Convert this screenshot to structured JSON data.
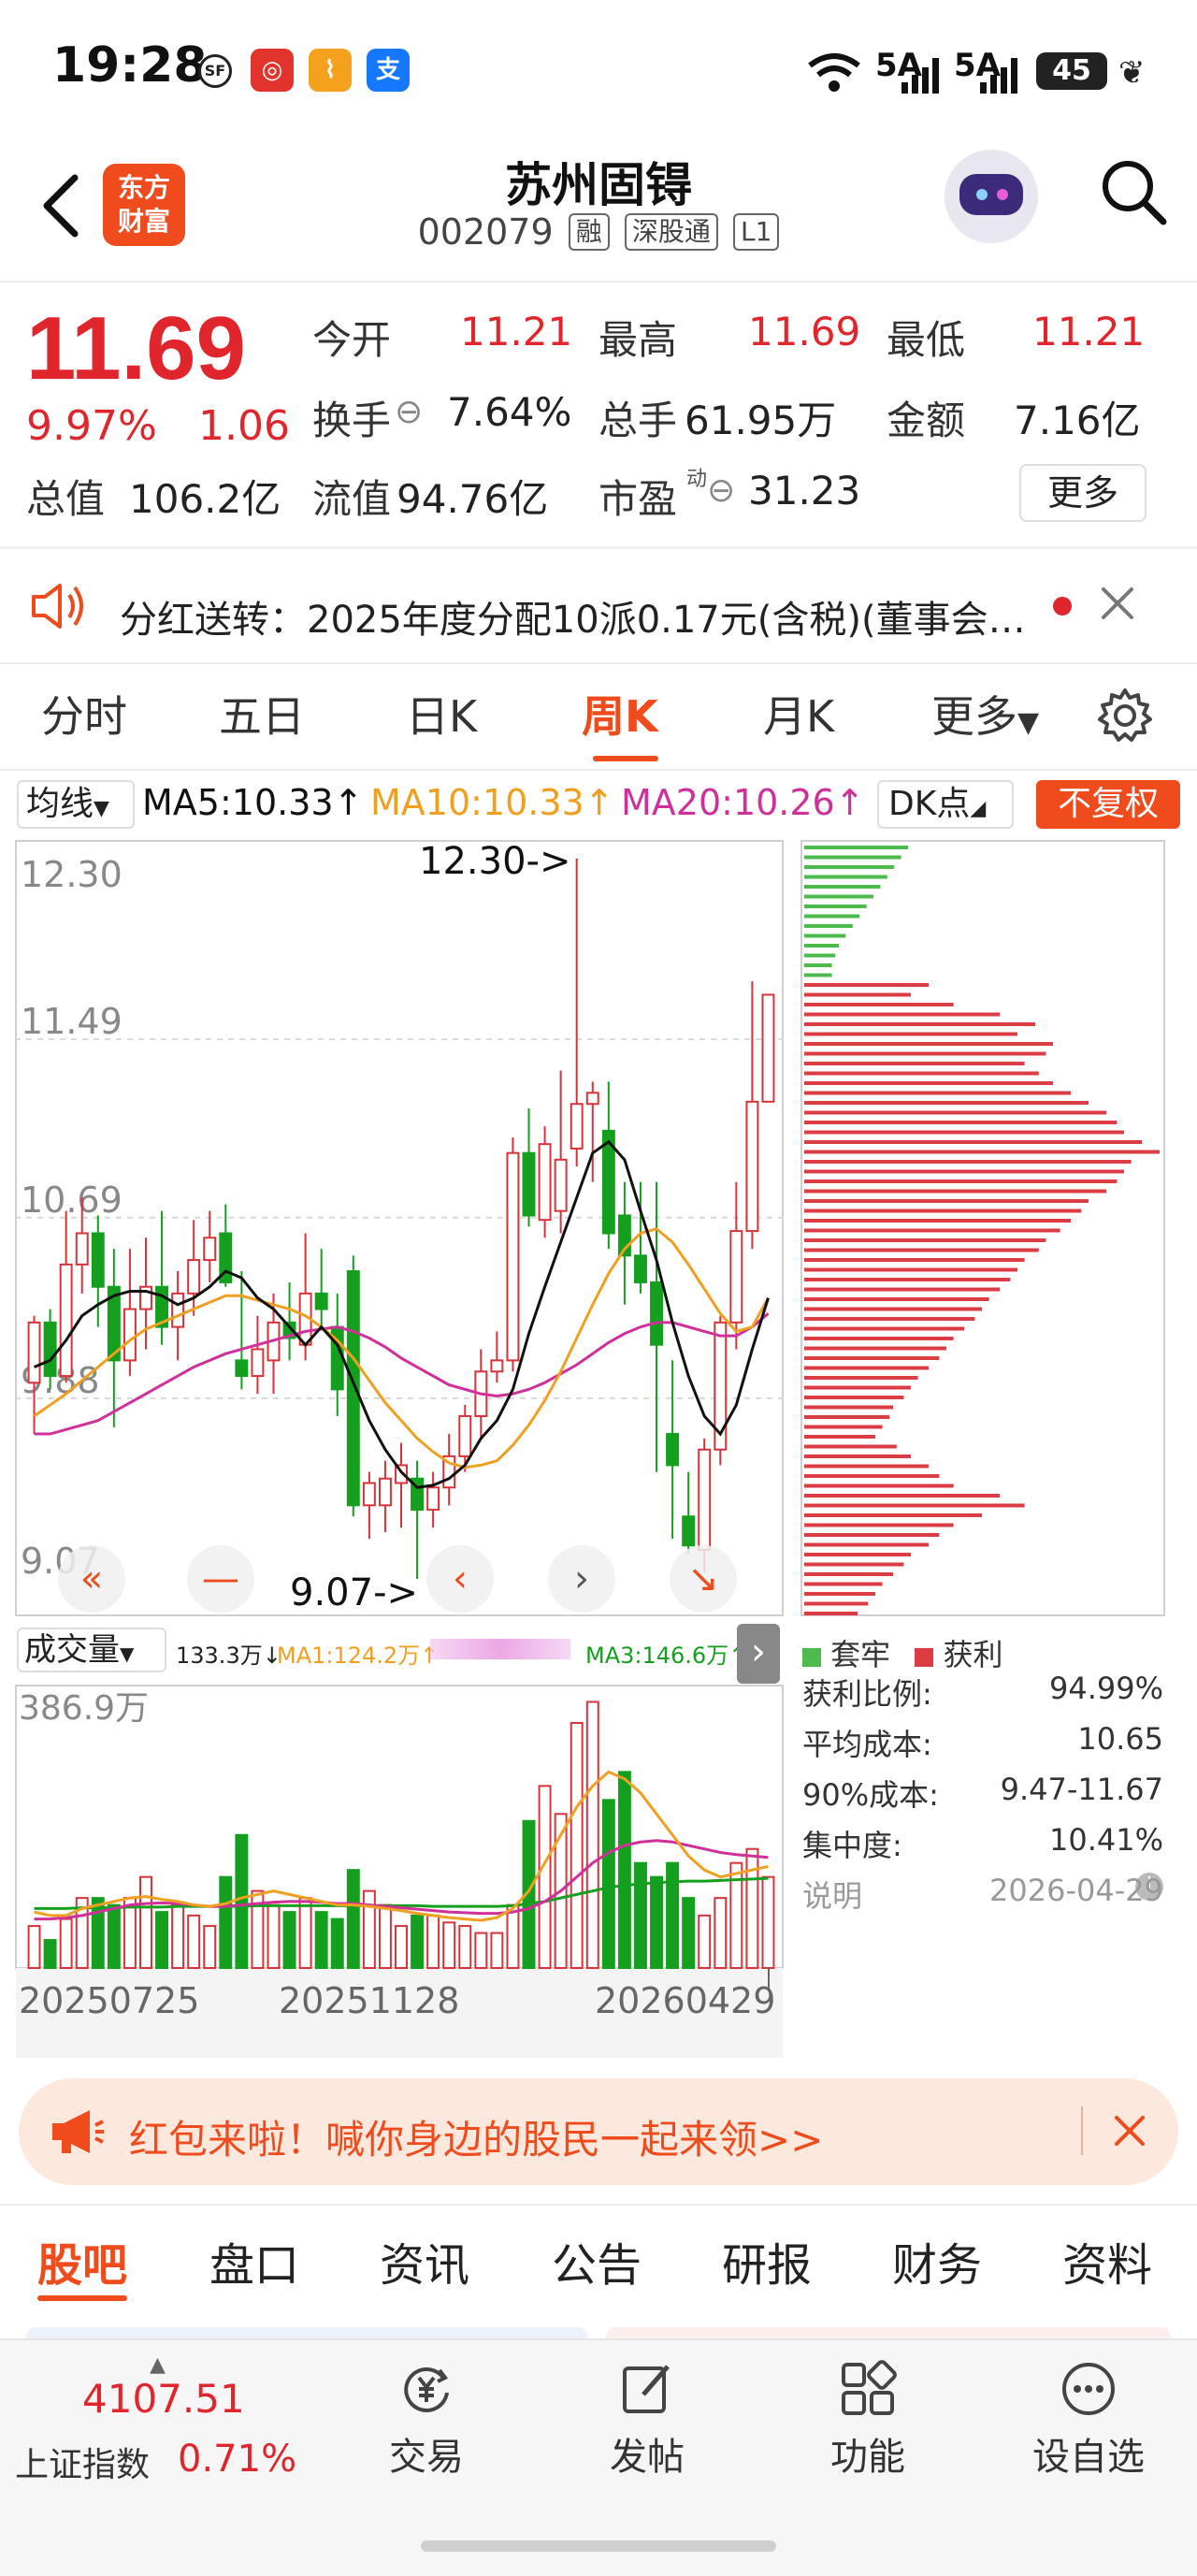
{
  "status_bar": {
    "time": "19:28",
    "signal_1": "5A",
    "signal_2": "5A",
    "battery": "45"
  },
  "header": {
    "logo_text_1": "东方",
    "logo_text_2": "财富",
    "stock_name": "苏州固锝",
    "stock_code": "002079",
    "tags": [
      "融",
      "深股通",
      "L1"
    ]
  },
  "quote": {
    "price": "11.69",
    "change_pct": "9.97%",
    "change": "1.06",
    "open_label": "今开",
    "open": "11.21",
    "high_label": "最高",
    "high": "11.69",
    "low_label": "最低",
    "low": "11.21",
    "turnover_label": "换手",
    "turnover": "7.64%",
    "volume_label": "总手",
    "volume": "61.95万",
    "amount_label": "金额",
    "amount": "7.16亿",
    "total_cap_label": "总值",
    "total_cap": "106.2亿",
    "float_cap_label": "流值",
    "float_cap": "94.76亿",
    "pe_label": "市盈",
    "pe_sup": "动",
    "pe": "31.23",
    "more_label": "更多"
  },
  "notice": {
    "text": "分红送转：2025年度分配10派0.17元(含税)(董事会…"
  },
  "chart_tabs": [
    "分时",
    "五日",
    "日K",
    "周K",
    "月K",
    "更多"
  ],
  "active_chart_tab": "周K",
  "ma": {
    "select_label": "均线",
    "ma5": "MA5:10.33↑",
    "ma10": "MA10:10.33↑",
    "ma20": "MA20:10.26↑",
    "dk_label": "DK点",
    "fuquan_label": "不复权",
    "colors": {
      "ma5": "#111111",
      "ma10": "#f0a020",
      "ma20": "#d0309a",
      "up": "#d8323a",
      "down": "#14a01e"
    }
  },
  "chart_data": {
    "type": "candlestick",
    "y_axis_labels": [
      "12.30",
      "11.49",
      "10.69",
      "9.88",
      "9.07"
    ],
    "ylim": [
      9.07,
      12.3
    ],
    "high_marker": "12.30->",
    "low_marker": "9.07->",
    "candles": [
      {
        "o": 9.95,
        "h": 10.25,
        "l": 9.72,
        "c": 10.22
      },
      {
        "o": 10.22,
        "h": 10.28,
        "l": 9.92,
        "c": 9.98
      },
      {
        "o": 9.98,
        "h": 10.72,
        "l": 9.95,
        "c": 10.48
      },
      {
        "o": 10.48,
        "h": 10.78,
        "l": 10.35,
        "c": 10.62
      },
      {
        "o": 10.62,
        "h": 10.7,
        "l": 10.2,
        "c": 10.38
      },
      {
        "o": 10.38,
        "h": 10.55,
        "l": 9.75,
        "c": 10.05
      },
      {
        "o": 10.05,
        "h": 10.55,
        "l": 9.98,
        "c": 10.28
      },
      {
        "o": 10.28,
        "h": 10.6,
        "l": 10.1,
        "c": 10.38
      },
      {
        "o": 10.38,
        "h": 10.72,
        "l": 10.12,
        "c": 10.2
      },
      {
        "o": 10.2,
        "h": 10.45,
        "l": 10.05,
        "c": 10.35
      },
      {
        "o": 10.35,
        "h": 10.68,
        "l": 10.25,
        "c": 10.5
      },
      {
        "o": 10.5,
        "h": 10.72,
        "l": 10.4,
        "c": 10.6
      },
      {
        "o": 10.62,
        "h": 10.75,
        "l": 10.38,
        "c": 10.4
      },
      {
        "o": 10.05,
        "h": 10.45,
        "l": 9.92,
        "c": 9.98
      },
      {
        "o": 9.98,
        "h": 10.25,
        "l": 9.9,
        "c": 10.1
      },
      {
        "o": 10.05,
        "h": 10.35,
        "l": 9.9,
        "c": 10.22
      },
      {
        "o": 10.22,
        "h": 10.4,
        "l": 10.05,
        "c": 10.15
      },
      {
        "o": 10.12,
        "h": 10.62,
        "l": 10.05,
        "c": 10.35
      },
      {
        "o": 10.35,
        "h": 10.55,
        "l": 10.2,
        "c": 10.28
      },
      {
        "o": 10.2,
        "h": 10.35,
        "l": 9.8,
        "c": 9.92
      },
      {
        "o": 10.45,
        "h": 10.52,
        "l": 9.35,
        "c": 9.4
      },
      {
        "o": 9.4,
        "h": 9.55,
        "l": 9.25,
        "c": 9.5
      },
      {
        "o": 9.4,
        "h": 9.6,
        "l": 9.28,
        "c": 9.52
      },
      {
        "o": 9.5,
        "h": 9.68,
        "l": 9.3,
        "c": 9.58
      },
      {
        "o": 9.52,
        "h": 9.6,
        "l": 9.07,
        "c": 9.38
      },
      {
        "o": 9.38,
        "h": 9.55,
        "l": 9.3,
        "c": 9.48
      },
      {
        "o": 9.48,
        "h": 9.72,
        "l": 9.4,
        "c": 9.62
      },
      {
        "o": 9.62,
        "h": 9.85,
        "l": 9.55,
        "c": 9.8
      },
      {
        "o": 9.8,
        "h": 10.1,
        "l": 9.7,
        "c": 10.0
      },
      {
        "o": 10.0,
        "h": 10.18,
        "l": 9.95,
        "c": 10.05
      },
      {
        "o": 10.05,
        "h": 11.05,
        "l": 10.0,
        "c": 10.98
      },
      {
        "o": 10.98,
        "h": 11.18,
        "l": 10.65,
        "c": 10.7
      },
      {
        "o": 10.68,
        "h": 11.1,
        "l": 10.6,
        "c": 11.02
      },
      {
        "o": 10.72,
        "h": 11.35,
        "l": 10.62,
        "c": 10.95
      },
      {
        "o": 11.0,
        "h": 12.3,
        "l": 10.92,
        "c": 11.2
      },
      {
        "o": 11.2,
        "h": 11.3,
        "l": 10.85,
        "c": 11.25
      },
      {
        "o": 11.08,
        "h": 11.3,
        "l": 10.55,
        "c": 10.62
      },
      {
        "o": 10.7,
        "h": 10.85,
        "l": 10.3,
        "c": 10.52
      },
      {
        "o": 10.52,
        "h": 10.85,
        "l": 10.35,
        "c": 10.4
      },
      {
        "o": 10.4,
        "h": 10.85,
        "l": 9.55,
        "c": 10.12
      },
      {
        "o": 9.72,
        "h": 10.05,
        "l": 9.25,
        "c": 9.58
      },
      {
        "o": 9.35,
        "h": 9.55,
        "l": 9.18,
        "c": 9.22
      },
      {
        "o": 9.2,
        "h": 9.7,
        "l": 9.1,
        "c": 9.65
      },
      {
        "o": 9.65,
        "h": 10.25,
        "l": 9.58,
        "c": 10.22
      },
      {
        "o": 10.22,
        "h": 10.85,
        "l": 10.1,
        "c": 10.63
      },
      {
        "o": 10.63,
        "h": 11.75,
        "l": 10.55,
        "c": 11.21
      },
      {
        "o": 11.21,
        "h": 11.69,
        "l": 11.21,
        "c": 11.69
      }
    ],
    "ma5": [
      10.02,
      10.05,
      10.14,
      10.25,
      10.3,
      10.34,
      10.36,
      10.36,
      10.34,
      10.3,
      10.33,
      10.38,
      10.45,
      10.42,
      10.33,
      10.28,
      10.2,
      10.12,
      10.2,
      10.12,
      9.95,
      9.78,
      9.65,
      9.55,
      9.48,
      9.49,
      9.52,
      9.58,
      9.7,
      9.78,
      9.92,
      10.17,
      10.38,
      10.58,
      10.78,
      10.98,
      11.03,
      10.95,
      10.72,
      10.5,
      10.22,
      9.98,
      9.8,
      9.72,
      9.85,
      10.1,
      10.33
    ],
    "ma10": [
      9.8,
      9.85,
      9.9,
      9.96,
      10.02,
      10.08,
      10.14,
      10.19,
      10.22,
      10.25,
      10.28,
      10.31,
      10.34,
      10.34,
      10.32,
      10.3,
      10.28,
      10.25,
      10.2,
      10.14,
      10.06,
      9.96,
      9.86,
      9.78,
      9.7,
      9.64,
      9.59,
      9.57,
      9.58,
      9.6,
      9.67,
      9.76,
      9.87,
      10.0,
      10.15,
      10.3,
      10.44,
      10.55,
      10.62,
      10.64,
      10.58,
      10.48,
      10.37,
      10.26,
      10.18,
      10.2,
      10.33
    ],
    "ma20": [
      9.72,
      9.72,
      9.74,
      9.76,
      9.78,
      9.82,
      9.86,
      9.9,
      9.94,
      9.98,
      10.02,
      10.05,
      10.08,
      10.1,
      10.12,
      10.14,
      10.16,
      10.18,
      10.19,
      10.2,
      10.18,
      10.15,
      10.11,
      10.06,
      10.02,
      9.98,
      9.94,
      9.92,
      9.9,
      9.89,
      9.9,
      9.92,
      9.95,
      9.99,
      10.03,
      10.08,
      10.13,
      10.17,
      10.2,
      10.22,
      10.22,
      10.2,
      10.18,
      10.16,
      10.16,
      10.2,
      10.26
    ],
    "volume": {
      "select_label": "成交量",
      "value": "133.3万↓",
      "ma1": "MA1:124.2万↑",
      "ma3": "MA3:146.6万↑",
      "y_max_label": "386.9万",
      "x_labels": [
        "20250725",
        "20251128",
        "20260429"
      ],
      "bars": [
        60,
        40,
        70,
        100,
        100,
        90,
        100,
        130,
        80,
        90,
        75,
        60,
        130,
        190,
        110,
        90,
        80,
        100,
        80,
        70,
        140,
        110,
        90,
        60,
        75,
        75,
        65,
        60,
        50,
        50,
        90,
        210,
        260,
        220,
        350,
        380,
        240,
        280,
        150,
        130,
        150,
        100,
        75,
        100,
        150,
        170,
        130
      ],
      "ma_a": [
        80,
        75,
        75,
        85,
        90,
        95,
        100,
        102,
        98,
        95,
        90,
        88,
        92,
        100,
        105,
        110,
        105,
        100,
        95,
        90,
        90,
        88,
        85,
        82,
        78,
        75,
        72,
        70,
        68,
        72,
        85,
        110,
        150,
        190,
        230,
        260,
        280,
        270,
        250,
        220,
        190,
        160,
        140,
        130,
        135,
        140,
        145
      ],
      "ma_b": [
        70,
        70,
        72,
        75,
        80,
        85,
        90,
        92,
        93,
        92,
        90,
        88,
        88,
        90,
        92,
        94,
        95,
        95,
        94,
        92,
        92,
        90,
        88,
        86,
        84,
        82,
        80,
        79,
        78,
        78,
        80,
        85,
        95,
        110,
        130,
        150,
        165,
        175,
        180,
        182,
        180,
        175,
        170,
        165,
        162,
        160,
        158
      ],
      "ma_c": [
        85,
        85,
        85,
        86,
        86,
        86,
        87,
        87,
        87,
        88,
        88,
        88,
        88,
        88,
        89,
        89,
        89,
        89,
        89,
        89,
        89,
        89,
        89,
        89,
        89,
        88,
        88,
        88,
        88,
        88,
        89,
        92,
        95,
        100,
        105,
        110,
        115,
        118,
        120,
        122,
        123,
        124,
        124,
        125,
        126,
        127,
        128
      ]
    },
    "chip": {
      "green_bars": [
        0.3,
        0.28,
        0.26,
        0.24,
        0.22,
        0.2,
        0.18,
        0.16,
        0.14,
        0.12,
        0.1,
        0.09,
        0.08,
        0.08
      ],
      "red_bars": [
        0.35,
        0.3,
        0.42,
        0.55,
        0.65,
        0.6,
        0.7,
        0.68,
        0.62,
        0.66,
        0.7,
        0.75,
        0.8,
        0.85,
        0.88,
        0.9,
        0.95,
        1.0,
        0.92,
        0.9,
        0.88,
        0.85,
        0.8,
        0.78,
        0.75,
        0.72,
        0.68,
        0.66,
        0.62,
        0.6,
        0.58,
        0.55,
        0.52,
        0.5,
        0.48,
        0.45,
        0.42,
        0.4,
        0.38,
        0.35,
        0.32,
        0.3,
        0.28,
        0.25,
        0.24,
        0.22,
        0.2,
        0.26,
        0.3,
        0.35,
        0.38,
        0.42,
        0.55,
        0.62,
        0.5,
        0.42,
        0.38,
        0.35,
        0.3,
        0.28,
        0.25,
        0.22,
        0.2,
        0.18,
        0.15,
        0.12,
        0.1,
        0.08
      ]
    }
  },
  "chip_stats": {
    "legend_trapped": "套牢",
    "legend_profit": "获利",
    "rows": [
      {
        "label": "获利比例:",
        "value": "94.99%"
      },
      {
        "label": "平均成本:",
        "value": "10.65"
      },
      {
        "label": "90%成本:",
        "value": "9.47-11.67"
      },
      {
        "label": "集中度:",
        "value": "10.41%"
      }
    ],
    "note_label": "说明",
    "date": "2026-04-29"
  },
  "promo": {
    "text": "红包来啦！喊你身边的股民一起来领>>"
  },
  "bottom_tabs": [
    "股吧",
    "盘口",
    "资讯",
    "公告",
    "研报",
    "财务",
    "资料"
  ],
  "bottom_nav": {
    "index_value": "4107.51",
    "index_name": "上证指数",
    "index_pct": "0.71%",
    "items": [
      "交易",
      "发帖",
      "功能",
      "设自选"
    ]
  }
}
